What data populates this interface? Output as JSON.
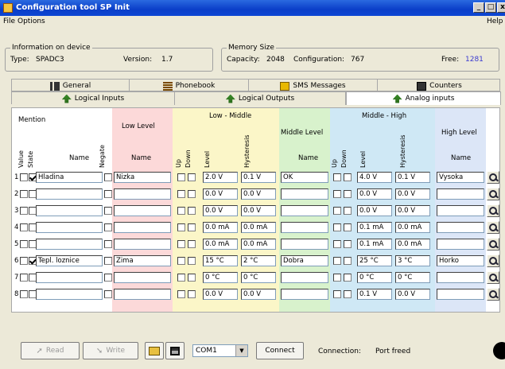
{
  "window": {
    "title": "Configuration tool SP Init"
  },
  "controls": {
    "minimize": "_",
    "maximize": "□",
    "close": "x"
  },
  "menu": {
    "file": "File",
    "options": "Options",
    "help": "Help"
  },
  "device": {
    "legend": "Information on device",
    "type_label": "Type:",
    "type_value": "SPADC3",
    "version_label": "Version:",
    "version_value": "1.7"
  },
  "memory": {
    "legend": "Memory Size",
    "capacity_label": "Capacity:",
    "capacity_value": "2048",
    "configuration_label": "Configuration:",
    "configuration_value": "767",
    "free_label": "Free:",
    "free_value": "1281",
    "free_color": "#3a3ad0"
  },
  "tabs_row1": [
    {
      "label": "General"
    },
    {
      "label": "Phonebook"
    },
    {
      "label": "SMS Messages"
    },
    {
      "label": "Counters"
    }
  ],
  "tabs_row2": [
    {
      "label": "Logical Inputs"
    },
    {
      "label": "Logical Outputs"
    },
    {
      "label": "Analog inputs"
    }
  ],
  "headers": {
    "mention": "Mention",
    "value": "Value",
    "state": "State",
    "name": "Name",
    "negate": "Negate",
    "low_level": "Low Level",
    "low_name": "Name",
    "low_middle": "Low - Middle",
    "up": "Up",
    "down": "Down",
    "level": "Level",
    "hysteresis": "Hysteresis",
    "middle_level": "Middle Level",
    "middle_name": "Name",
    "middle_high": "Middle - High",
    "high_level": "High Level",
    "high_name": "Name"
  },
  "band_colors": {
    "low": "#fcd9d9",
    "lowmid": "#fbf6c8",
    "middle": "#d8f2cc",
    "midhigh": "#cfe8f5",
    "high": "#dce6f7"
  },
  "rows": [
    {
      "num": "1",
      "state": true,
      "name": "Hladina",
      "low_name": "Nizka",
      "lm_level": "2.0 V",
      "lm_hyst": "0.1 V",
      "mid_name": "OK",
      "mh_level": "4.0 V",
      "mh_hyst": "0.1 V",
      "high_name": "Vysoka"
    },
    {
      "num": "2",
      "state": false,
      "name": "",
      "low_name": "",
      "lm_level": "0.0 V",
      "lm_hyst": "0.0 V",
      "mid_name": "",
      "mh_level": "0.0 V",
      "mh_hyst": "0.0 V",
      "high_name": ""
    },
    {
      "num": "3",
      "state": false,
      "name": "",
      "low_name": "",
      "lm_level": "0.0 V",
      "lm_hyst": "0.0 V",
      "mid_name": "",
      "mh_level": "0.0 V",
      "mh_hyst": "0.0 V",
      "high_name": ""
    },
    {
      "num": "4",
      "state": false,
      "name": "",
      "low_name": "",
      "lm_level": "0.0 mA",
      "lm_hyst": "0.0 mA",
      "mid_name": "",
      "mh_level": "0.1 mA",
      "mh_hyst": "0.0 mA",
      "high_name": ""
    },
    {
      "num": "5",
      "state": false,
      "name": "",
      "low_name": "",
      "lm_level": "0.0 mA",
      "lm_hyst": "0.0 mA",
      "mid_name": "",
      "mh_level": "0.1 mA",
      "mh_hyst": "0.0 mA",
      "high_name": ""
    },
    {
      "num": "6",
      "state": true,
      "name": "Tepl. loznice",
      "low_name": "Zima",
      "lm_level": "15 °C",
      "lm_hyst": "2 °C",
      "mid_name": "Dobra",
      "mh_level": "25 °C",
      "mh_hyst": "3 °C",
      "high_name": "Horko"
    },
    {
      "num": "7",
      "state": false,
      "name": "",
      "low_name": "",
      "lm_level": "0 °C",
      "lm_hyst": "0 °C",
      "mid_name": "",
      "mh_level": "0 °C",
      "mh_hyst": "0 °C",
      "high_name": ""
    },
    {
      "num": "8",
      "state": false,
      "name": "",
      "low_name": "",
      "lm_level": "0.0 V",
      "lm_hyst": "0.0 V",
      "mid_name": "",
      "mh_level": "0.1 V",
      "mh_hyst": "0.0 V",
      "high_name": ""
    }
  ],
  "bottom": {
    "read": "Read",
    "write": "Write",
    "port": "COM1",
    "connect": "Connect",
    "connection_label": "Connection:",
    "connection_value": "Port freed"
  },
  "icons": {
    "read": "read-arrow-icon",
    "write": "write-arrow-icon",
    "open": "folder-open-icon",
    "save": "floppy-disk-icon",
    "search": "magnifier-icon"
  }
}
